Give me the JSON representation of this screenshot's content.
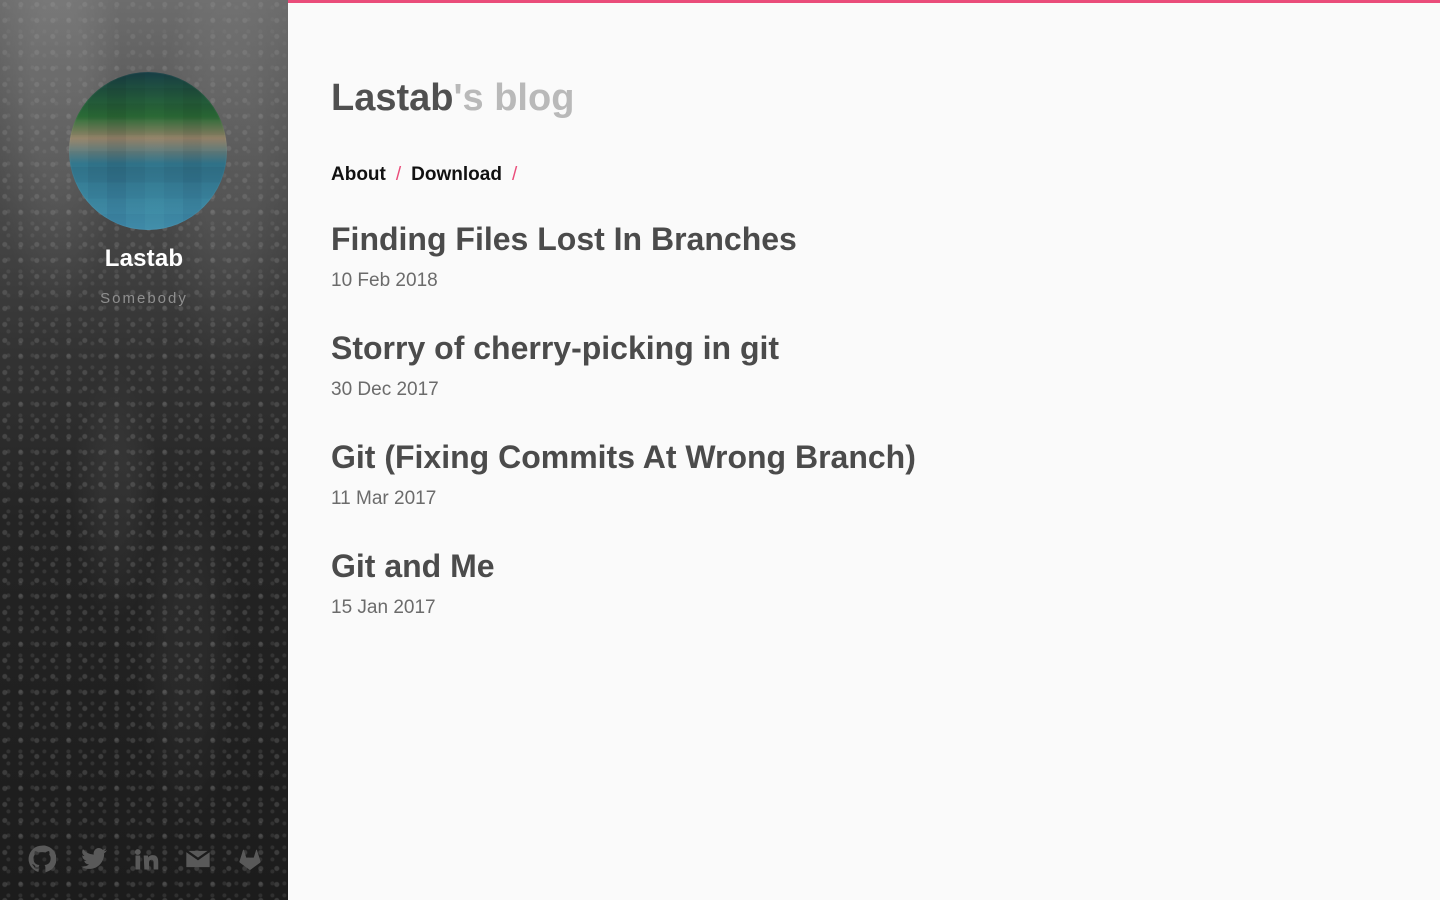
{
  "sidebar": {
    "author_name": "Lastab",
    "author_role": "Somebody",
    "social_icons": [
      "github-icon",
      "twitter-icon",
      "linkedin-icon",
      "mail-icon",
      "gitlab-icon"
    ]
  },
  "header": {
    "owner": "Lastab",
    "suffix": "'s blog"
  },
  "nav": {
    "items": [
      {
        "label": "About"
      },
      {
        "label": "Download"
      }
    ],
    "separator": "/"
  },
  "posts": [
    {
      "title": "Finding Files Lost In Branches",
      "date": "10 Feb 2018"
    },
    {
      "title": "Storry of cherry-picking in git",
      "date": "30 Dec 2017"
    },
    {
      "title": "Git (Fixing Commits At Wrong Branch)",
      "date": "11 Mar 2017"
    },
    {
      "title": "Git and Me",
      "date": "15 Jan 2017"
    }
  ],
  "colors": {
    "accent": "#ea4c7a",
    "sidebar_dark": "#1c1c1c",
    "main_bg": "#fafafa",
    "title_text": "#505050",
    "title_muted": "#b9b9b9"
  }
}
